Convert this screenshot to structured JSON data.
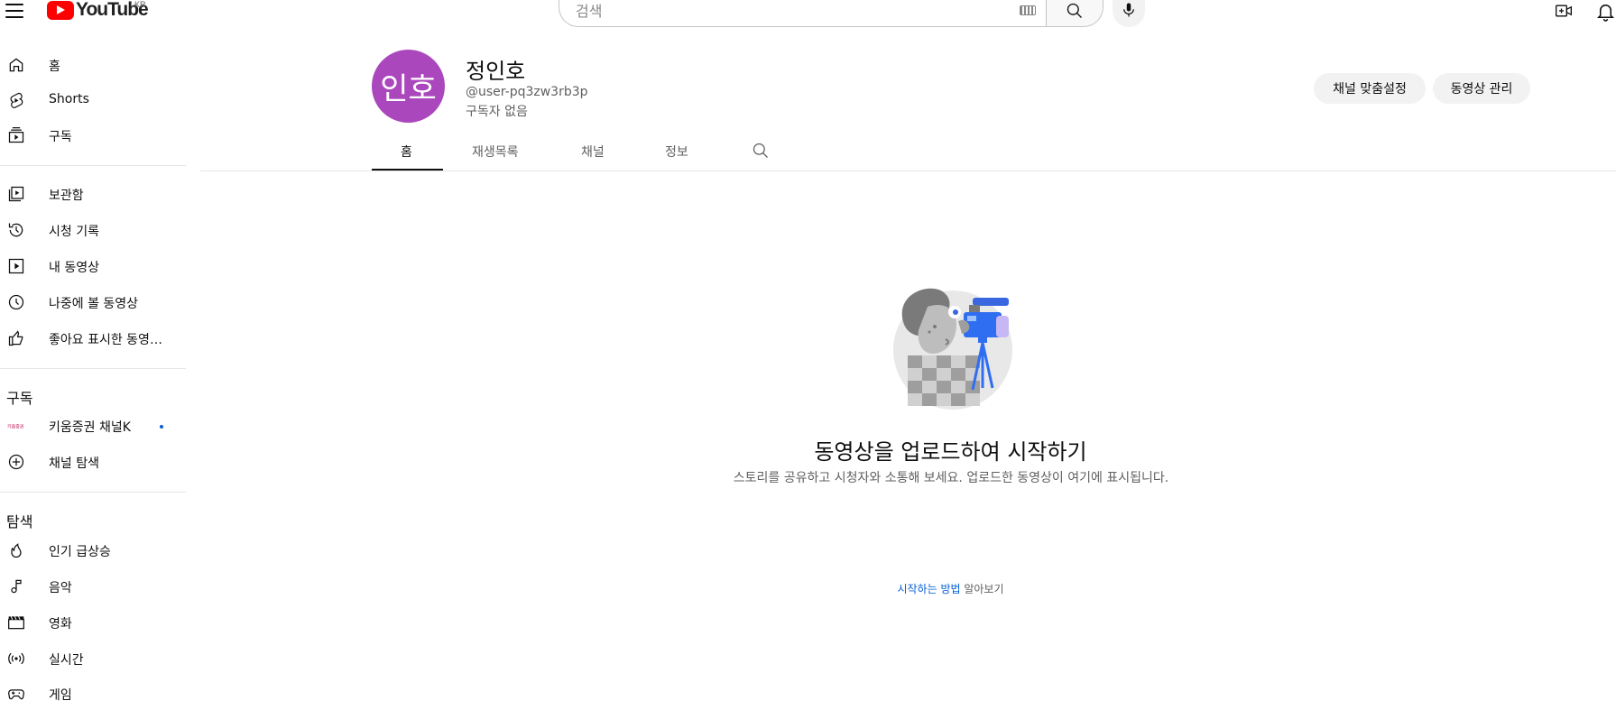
{
  "header": {
    "logo_text": "YouTube",
    "region": "KR",
    "search_placeholder": "검색"
  },
  "sidebar": {
    "main": [
      {
        "label": "홈",
        "icon": "home-icon"
      },
      {
        "label": "Shorts",
        "icon": "shorts-icon"
      },
      {
        "label": "구독",
        "icon": "subscriptions-icon"
      }
    ],
    "you": [
      {
        "label": "보관함",
        "icon": "library-icon"
      },
      {
        "label": "시청 기록",
        "icon": "history-icon"
      },
      {
        "label": "내 동영상",
        "icon": "your-videos-icon"
      },
      {
        "label": "나중에 볼 동영상",
        "icon": "watch-later-icon"
      },
      {
        "label": "좋아요 표시한 동영…",
        "icon": "liked-videos-icon"
      }
    ],
    "subscriptions_title": "구독",
    "subscriptions": [
      {
        "label": "키움증권 채널K",
        "icon": "channel-avatar-icon",
        "has_new": true
      },
      {
        "label": "채널 탐색",
        "icon": "add-circle-icon"
      }
    ],
    "explore_title": "탐색",
    "explore": [
      {
        "label": "인기 급상승",
        "icon": "trending-icon"
      },
      {
        "label": "음악",
        "icon": "music-icon"
      },
      {
        "label": "영화",
        "icon": "movies-icon"
      },
      {
        "label": "실시간",
        "icon": "live-icon"
      },
      {
        "label": "게임",
        "icon": "gaming-icon"
      }
    ]
  },
  "channel": {
    "avatar_text": "인호",
    "avatar_color": "#ab47bc",
    "name": "정인호",
    "handle": "@user-pq3zw3rb3p",
    "subscribers": "구독자 없음",
    "customize_button": "채널 맞춤설정",
    "manage_button": "동영상 관리",
    "tabs": [
      "홈",
      "재생목록",
      "채널",
      "정보"
    ],
    "active_tab": "홈"
  },
  "empty_state": {
    "title": "동영상을 업로드하여 시작하기",
    "description": "스토리를 공유하고 시청자와 소통해 보세요. 업로드한 동영상이 여기에 표시됩니다.",
    "link_text": "시작하는 방법",
    "link_suffix": " 알아보기"
  },
  "colors": {
    "brand_red": "#ff0000",
    "link_blue": "#065fd4"
  }
}
